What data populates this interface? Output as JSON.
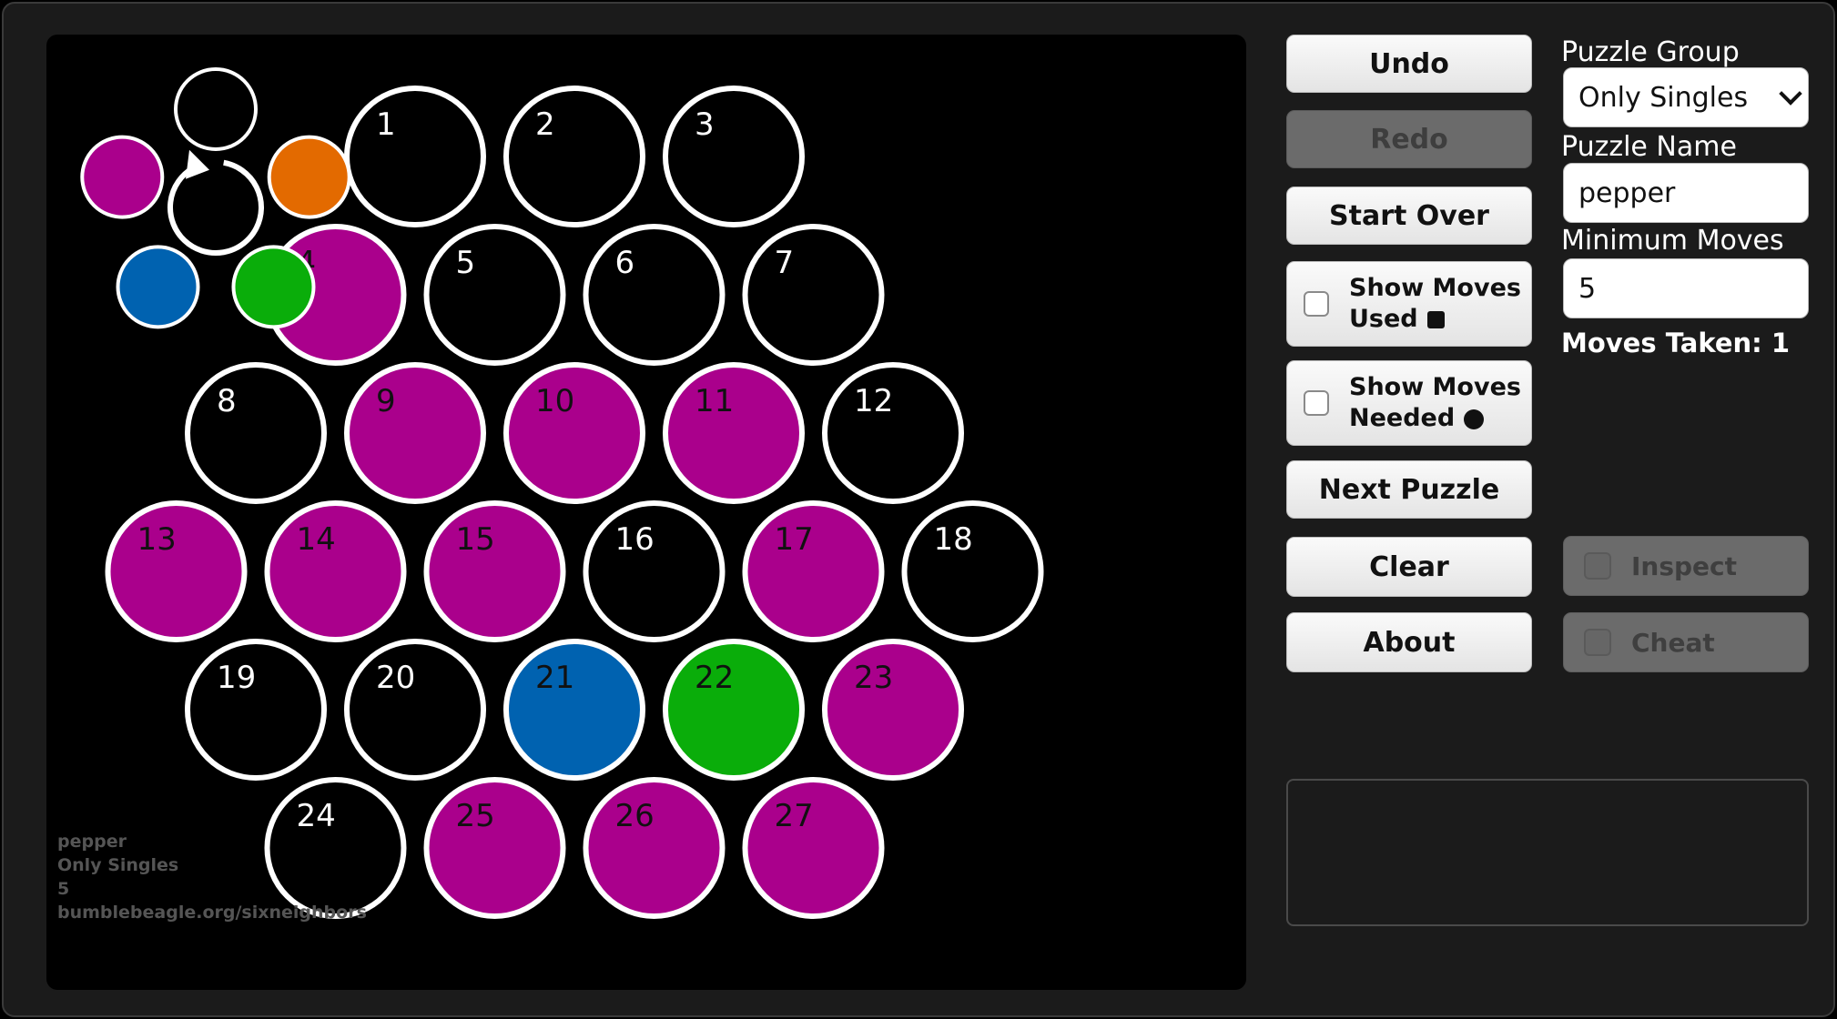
{
  "buttons": {
    "undo": "Undo",
    "redo": "Redo",
    "start_over": "Start Over",
    "show_moves_used_line1": "Show Moves",
    "show_moves_used_line2": "Used",
    "show_moves_needed_line1": "Show Moves",
    "show_moves_needed_line2": "Needed",
    "next_puzzle": "Next Puzzle",
    "clear": "Clear",
    "about": "About",
    "inspect": "Inspect",
    "cheat": "Cheat"
  },
  "settings": {
    "puzzle_group_label": "Puzzle Group",
    "puzzle_group_value": "Only Singles",
    "puzzle_name_label": "Puzzle Name",
    "puzzle_name_value": "pepper",
    "minimum_moves_label": "Minimum Moves",
    "minimum_moves_value": "5",
    "moves_taken": "Moves Taken: 1"
  },
  "board_info": {
    "name": "pepper",
    "group": "Only Singles",
    "min_moves": "5",
    "site": "bumblebeagle.org/sixneighbors"
  },
  "colors": {
    "empty": "#000000",
    "magenta": "#aa008c",
    "orange": "#e36a00",
    "blue": "#0062b0",
    "green": "#0aad0a",
    "outline": "#ffffff"
  },
  "palette": [
    "empty",
    "orange",
    "green",
    "blue",
    "magenta"
  ],
  "cells": [
    {
      "n": "1",
      "color": "empty"
    },
    {
      "n": "2",
      "color": "empty"
    },
    {
      "n": "3",
      "color": "empty"
    },
    {
      "n": "4",
      "color": "magenta"
    },
    {
      "n": "5",
      "color": "empty"
    },
    {
      "n": "6",
      "color": "empty"
    },
    {
      "n": "7",
      "color": "empty"
    },
    {
      "n": "8",
      "color": "empty"
    },
    {
      "n": "9",
      "color": "magenta"
    },
    {
      "n": "10",
      "color": "magenta"
    },
    {
      "n": "11",
      "color": "magenta"
    },
    {
      "n": "12",
      "color": "empty"
    },
    {
      "n": "13",
      "color": "magenta"
    },
    {
      "n": "14",
      "color": "magenta"
    },
    {
      "n": "15",
      "color": "magenta"
    },
    {
      "n": "16",
      "color": "empty"
    },
    {
      "n": "17",
      "color": "magenta"
    },
    {
      "n": "18",
      "color": "empty"
    },
    {
      "n": "19",
      "color": "empty"
    },
    {
      "n": "20",
      "color": "empty"
    },
    {
      "n": "21",
      "color": "blue"
    },
    {
      "n": "22",
      "color": "green"
    },
    {
      "n": "23",
      "color": "magenta"
    },
    {
      "n": "24",
      "color": "empty"
    },
    {
      "n": "25",
      "color": "magenta"
    },
    {
      "n": "26",
      "color": "magenta"
    },
    {
      "n": "27",
      "color": "magenta"
    }
  ]
}
